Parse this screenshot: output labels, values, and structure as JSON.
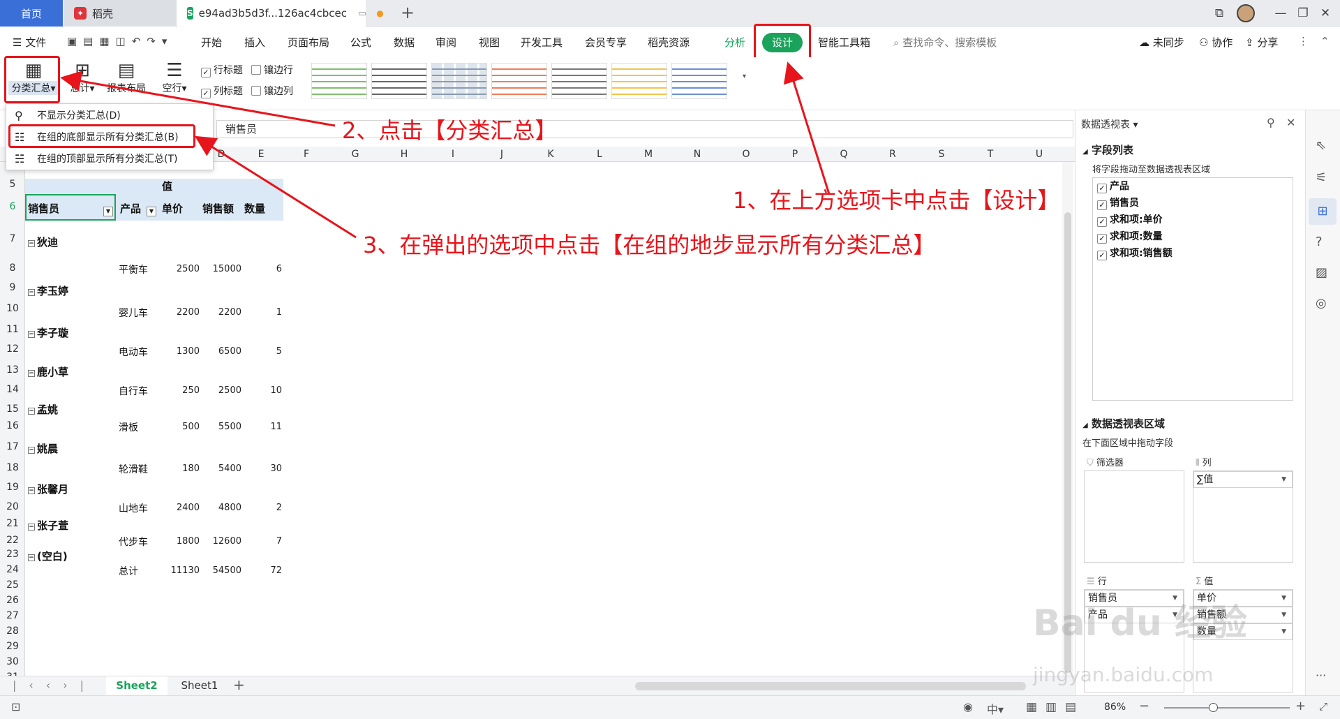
{
  "tabs": {
    "home": "首页",
    "daoke": "稻壳",
    "file": "e94ad3b5d3f...126ac4cbcec"
  },
  "menu": {
    "file": "文件",
    "items": [
      "开始",
      "插入",
      "页面布局",
      "公式",
      "数据",
      "审阅",
      "视图",
      "开发工具",
      "会员专享",
      "稻壳资源"
    ],
    "analyze": "分析",
    "design": "设计",
    "toolbox": "智能工具箱",
    "search": "查找命令、搜索模板",
    "sync": "未同步",
    "collab": "协作",
    "share": "分享"
  },
  "ribbon": {
    "subtotal": "分类汇总",
    "total": "总计",
    "layout": "报表布局",
    "blank": "空行",
    "row_header": "行标题",
    "banded_rows": "镶边行",
    "col_header": "列标题",
    "banded_cols": "镶边列"
  },
  "dropdown": {
    "opt1": "不显示分类汇总(D)",
    "opt2": "在组的底部显示所有分类汇总(B)",
    "opt3": "在组的顶部显示所有分类汇总(T)"
  },
  "formula": "销售员",
  "columns": [
    "D",
    "E",
    "F",
    "G",
    "H",
    "I",
    "J",
    "K",
    "L",
    "M",
    "N",
    "O",
    "P",
    "Q",
    "R",
    "S",
    "T",
    "U"
  ],
  "pivot": {
    "value_hdr": "值",
    "h_person": "销售员",
    "h_product": "产品",
    "h_price": "单价",
    "h_amount": "销售额",
    "h_qty": "数量",
    "groups": [
      {
        "name": "狄迪",
        "product": "平衡车",
        "price": "2500",
        "amount": "15000",
        "qty": "6"
      },
      {
        "name": "李玉婷",
        "product": "婴儿车",
        "price": "2200",
        "amount": "2200",
        "qty": "1"
      },
      {
        "name": "李子璇",
        "product": "电动车",
        "price": "1300",
        "amount": "6500",
        "qty": "5"
      },
      {
        "name": "鹿小草",
        "product": "自行车",
        "price": "250",
        "amount": "2500",
        "qty": "10"
      },
      {
        "name": "孟姚",
        "product": "滑板",
        "price": "500",
        "amount": "5500",
        "qty": "11"
      },
      {
        "name": "姚晨",
        "product": "轮滑鞋",
        "price": "180",
        "amount": "5400",
        "qty": "30"
      },
      {
        "name": "张馨月",
        "product": "山地车",
        "price": "2400",
        "amount": "4800",
        "qty": "2"
      },
      {
        "name": "张子萱",
        "product": "代步车",
        "price": "1800",
        "amount": "12600",
        "qty": "7"
      },
      {
        "name": "(空白)",
        "product": "总计",
        "price": "11130",
        "amount": "54500",
        "qty": "72"
      }
    ]
  },
  "sheets": {
    "s2": "Sheet2",
    "s1": "Sheet1"
  },
  "zoom": "86%",
  "pane": {
    "title": "数据透视表",
    "field_list": "字段列表",
    "hint": "将字段拖动至数据透视表区域",
    "fields": [
      "产品",
      "销售员",
      "求和项:单价",
      "求和项:数量",
      "求和项:销售额"
    ],
    "area_title": "数据透视表区域",
    "area_hint": "在下面区域中拖动字段",
    "filter": "筛选器",
    "col": "列",
    "row": "行",
    "val": "值",
    "col_item": "∑值",
    "row_items": [
      "销售员",
      "产品"
    ],
    "val_items": [
      "单价",
      "销售额",
      "数量"
    ]
  },
  "annotations": {
    "a1": "1、在上方选项卡中点击【设计】",
    "a2": "2、点击【分类汇总】",
    "a3": "3、在弹出的选项中点击【在组的地步显示所有分类汇总】"
  },
  "watermark": {
    "brand": "Bai du 经验",
    "url": "jingyan.baidu.com"
  },
  "accent": "#19a35b"
}
